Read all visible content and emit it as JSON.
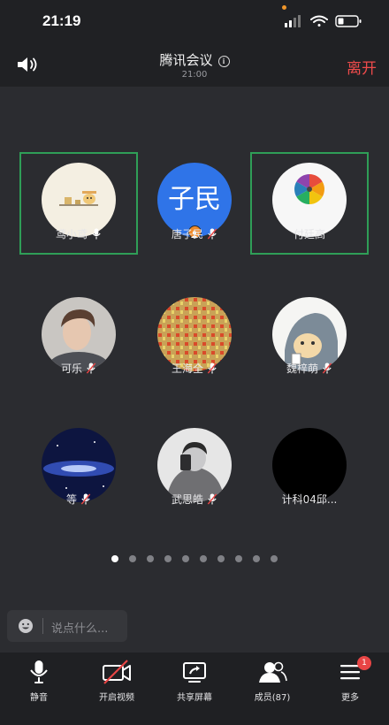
{
  "status_bar": {
    "time": "21:19"
  },
  "header": {
    "title": "腾讯会议",
    "info_icon": "ⓘ",
    "time": "21:00",
    "leave_label": "离开"
  },
  "participants": [
    {
      "name": "鸢小鸢",
      "mic": "on",
      "active": true
    },
    {
      "name": "唐子民",
      "mic": "muted",
      "avatar_text": "子民",
      "host": true
    },
    {
      "name": "付廷高",
      "mic": "none",
      "active": true
    },
    {
      "name": "可乐",
      "mic": "muted"
    },
    {
      "name": "王海全",
      "mic": "muted"
    },
    {
      "name": "魏梓萌",
      "mic": "muted"
    },
    {
      "name": "等",
      "mic": "muted"
    },
    {
      "name": "武思皓",
      "mic": "muted"
    },
    {
      "name": "计科04邱...",
      "mic": "none"
    }
  ],
  "pager": {
    "pages": 10,
    "current": 1
  },
  "chat": {
    "placeholder": "说点什么..."
  },
  "toolbar": {
    "mute_label": "静音",
    "video_label": "开启视频",
    "share_label": "共享屏幕",
    "members_label": "成员(87)",
    "more_label": "更多",
    "more_badge": "1"
  },
  "colors": {
    "background": "#2b2c30",
    "active_border": "#2f9e57",
    "leave": "#ee4b4b",
    "avatar_blue": "#2f74e8",
    "muted_red": "#e84545"
  }
}
